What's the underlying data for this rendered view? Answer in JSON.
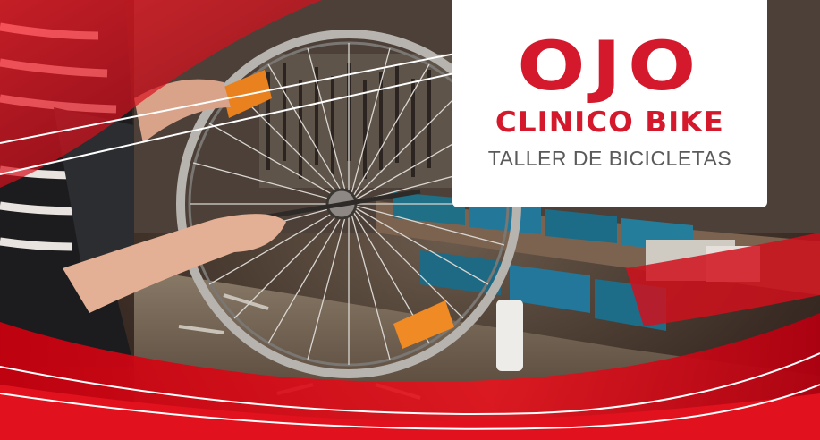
{
  "brand": {
    "name": "OJO",
    "subtitle": "CLINICO BIKE",
    "tagline": "TALLER DE BICICLETAS"
  },
  "colors": {
    "brand_red": "#d4192c",
    "tagline_gray": "#5a5a5a",
    "card_bg": "#ffffff",
    "overlay_red": "#e0101c"
  },
  "photo": {
    "subject": "mechanic truing a bicycle wheel in a workshop"
  }
}
